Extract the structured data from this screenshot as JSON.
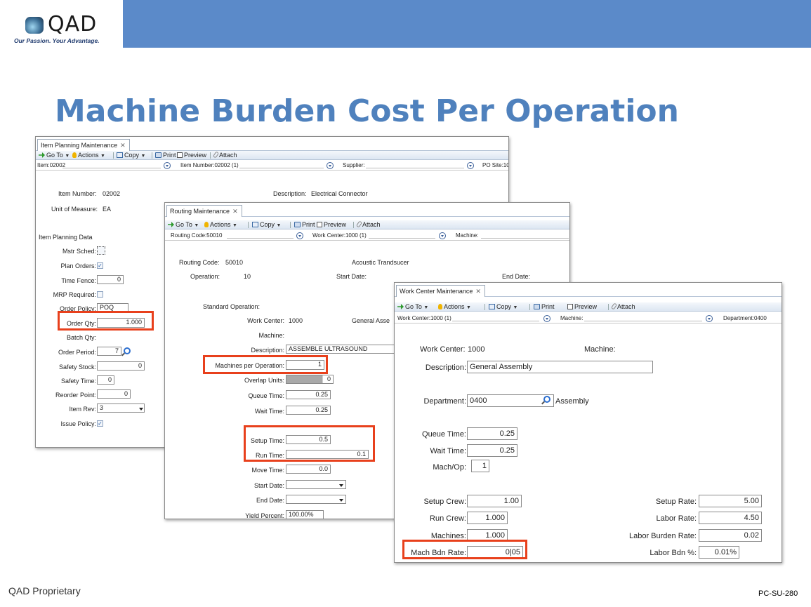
{
  "header": {
    "logo_text": "QAD",
    "tagline": "Our Passion. Your Advantage."
  },
  "slide_title": "Machine Burden Cost Per Operation",
  "footer": {
    "left": "QAD Proprietary",
    "right": "PC-SU-280"
  },
  "toolbar": {
    "goto": "Go To",
    "actions": "Actions",
    "copy": "Copy",
    "print": "Print",
    "preview": "Preview",
    "attach": "Attach"
  },
  "colors": {
    "banner": "#5b8ac9",
    "title": "#4f81bd",
    "highlight": "#e8401c"
  },
  "item_planning": {
    "tab": "Item Planning Maintenance",
    "filter": {
      "item": "Item:02002",
      "item_number": "Item Number:02002 (1)",
      "supplier": "Supplier:",
      "po_site": "PO Site:10"
    },
    "item_number_label": "Item Number:",
    "item_number_value": "02002",
    "description_label": "Description:",
    "description_value": "Electrical Connector",
    "uom_label": "Unit of Measure:",
    "uom_value": "EA",
    "section": "Item Planning Data",
    "mstr_sched": "Mstr Sched:",
    "plan_orders": "Plan Orders:",
    "time_fence": "Time Fence:",
    "time_fence_value": "0",
    "mrp_required": "MRP Required:",
    "order_policy": "Order Policy:",
    "order_policy_value": "POQ",
    "order_qty": "Order Qty:",
    "order_qty_value": "1.000",
    "batch_qty": "Batch Qty:",
    "order_period": "Order Period:",
    "order_period_value": "7",
    "safety_stock": "Safety Stock:",
    "safety_stock_value": "0",
    "safety_time": "Safety Time:",
    "safety_time_value": "0",
    "reorder_point": "Reorder Point:",
    "reorder_point_value": "0",
    "item_rev": "Item Rev:",
    "item_rev_value": "3",
    "issue_policy": "Issue Policy:"
  },
  "routing": {
    "tab": "Routing Maintenance",
    "filter": {
      "routing_code": "Routing Code:50010",
      "work_center": "Work Center:1000 (1)",
      "machine": "Machine:"
    },
    "routing_code_label": "Routing Code:",
    "routing_code_value": "50010",
    "routing_desc": "Acoustic Trandsucer",
    "operation_label": "Operation:",
    "operation_value": "10",
    "start_date_label": "Start Date:",
    "end_date_label": "End Date:",
    "standard_operation": "Standard Operation:",
    "work_center_label": "Work Center:",
    "work_center_value": "1000",
    "work_center_desc": "General Asse",
    "machine_label": "Machine:",
    "description_label": "Description:",
    "description_value": "ASSEMBLE ULTRASOUND",
    "machines_per_op": "Machines per Operation:",
    "machines_per_op_value": "1",
    "overlap_units": "Overlap Units:",
    "overlap_units_value": "0",
    "queue_time": "Queue Time:",
    "queue_time_value": "0.25",
    "wait_time": "Wait Time:",
    "wait_time_value": "0.25",
    "setup_time": "Setup Time:",
    "setup_time_value": "0.5",
    "run_time": "Run Time:",
    "run_time_value": "0.1",
    "move_time": "Move Time:",
    "move_time_value": "0.0",
    "start_date": "Start Date:",
    "end_date": "End Date:",
    "yield_percent": "Yield Percent:",
    "yield_percent_value": "100.00%"
  },
  "work_center": {
    "tab": "Work Center Maintenance",
    "filter": {
      "work_center": "Work Center:1000 (1)",
      "machine": "Machine:",
      "department": "Department:0400"
    },
    "work_center_label": "Work Center:",
    "work_center_value": "1000",
    "machine_label": "Machine:",
    "description_label": "Description:",
    "description_value": "General Assembly",
    "department_label": "Department:",
    "department_value": "0400",
    "department_desc": "Assembly",
    "queue_time": "Queue Time:",
    "queue_time_value": "0.25",
    "wait_time": "Wait Time:",
    "wait_time_value": "0.25",
    "mach_op": "Mach/Op:",
    "mach_op_value": "1",
    "setup_crew": "Setup Crew:",
    "setup_crew_value": "1.00",
    "run_crew": "Run Crew:",
    "run_crew_value": "1.000",
    "machines": "Machines:",
    "machines_value": "1.000",
    "mach_bdn_rate": "Mach Bdn Rate:",
    "mach_bdn_rate_value": "0|05",
    "setup_rate": "Setup Rate:",
    "setup_rate_value": "5.00",
    "labor_rate": "Labor Rate:",
    "labor_rate_value": "4.50",
    "labor_burden_rate": "Labor Burden Rate:",
    "labor_burden_rate_value": "0.02",
    "labor_bdn_pct": "Labor Bdn %:",
    "labor_bdn_pct_value": "0.01%"
  }
}
